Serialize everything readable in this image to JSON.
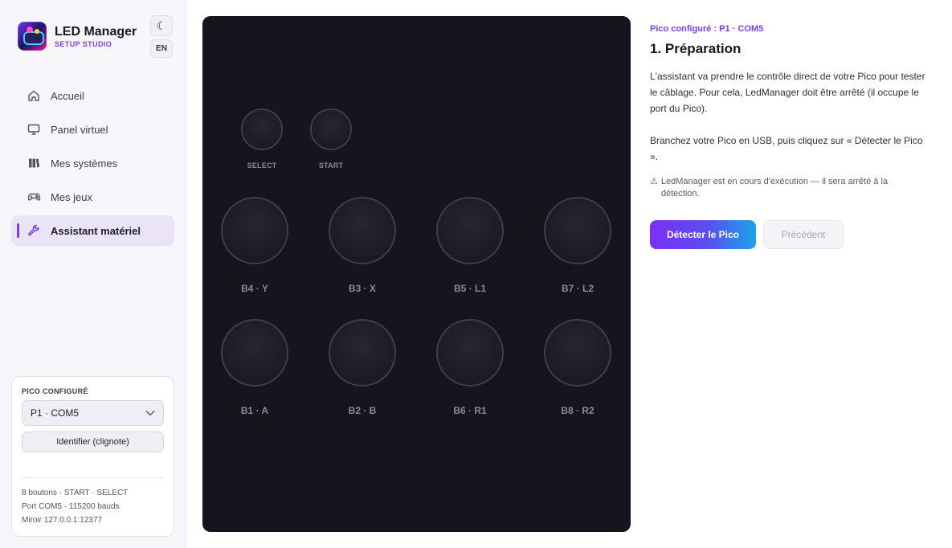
{
  "app": {
    "title": "LED Manager",
    "subtitle": "SETUP STUDIO",
    "theme_icon": "moon-icon",
    "lang": "EN"
  },
  "nav": {
    "items": [
      {
        "label": "Accueil",
        "icon": "home-icon",
        "active": false
      },
      {
        "label": "Panel virtuel",
        "icon": "monitor-icon",
        "active": false
      },
      {
        "label": "Mes systèmes",
        "icon": "library-icon",
        "active": false
      },
      {
        "label": "Mes jeux",
        "icon": "gamepad-icon",
        "active": false
      },
      {
        "label": "Assistant matériel",
        "icon": "wrench-icon",
        "active": true
      }
    ]
  },
  "pico_card": {
    "label": "PICO CONFIGURÉ",
    "selected": "P1 · COM5",
    "identify_label": "Identifier (clignote)",
    "info": [
      "8 boutons · START · SELECT",
      "Port COM5 · 115200 bauds",
      "Miroir 127.0.0.1:12377"
    ]
  },
  "panel": {
    "small_buttons": [
      {
        "label": "SELECT"
      },
      {
        "label": "START"
      }
    ],
    "buttons": [
      {
        "label": "B4 · Y"
      },
      {
        "label": "B3 · X"
      },
      {
        "label": "B5 · L1"
      },
      {
        "label": "B7 · L2"
      },
      {
        "label": "B1 · A"
      },
      {
        "label": "B2 · B"
      },
      {
        "label": "B6 · R1"
      },
      {
        "label": "B8 · R2"
      }
    ]
  },
  "wizard": {
    "status": "Pico configuré : P1 · COM5",
    "title": "1. Préparation",
    "paragraph1": "L'assistant va prendre le contrôle direct de votre Pico pour tester le câblage. Pour cela, LedManager doit être arrêté (il occupe le port du Pico).",
    "paragraph2": "Branchez votre Pico en USB, puis cliquez sur « Détecter le Pico ».",
    "warning_icon": "warning-icon",
    "warning": "LedManager est en cours d'exécution — il sera arrêté à la détection.",
    "primary_label": "Détecter le Pico",
    "secondary_label": "Précédent"
  },
  "colors": {
    "accent": "#7b3fe4",
    "panel_bg": "#15151e",
    "button_ring": "#3d3d4c"
  }
}
